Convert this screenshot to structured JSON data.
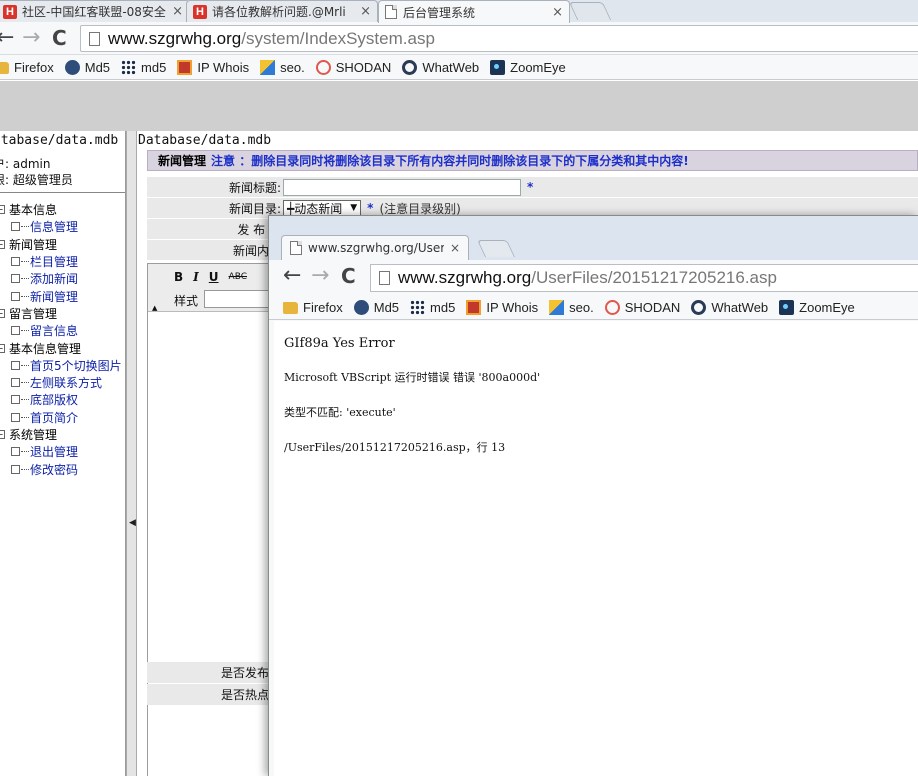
{
  "back_browser": {
    "tabs": [
      {
        "title": "社区-中国红客联盟-08安全",
        "favicon": "h-logo-icon"
      },
      {
        "title": "请各位教解析问题.@Mrli",
        "favicon": "h-logo-icon"
      },
      {
        "title": "后台管理系统",
        "favicon": "page-icon"
      }
    ],
    "close_glyph": "×",
    "back_glyph": "←",
    "forward_glyph": "→",
    "reload_glyph": "C",
    "url_host": "www.szgrwhg.org",
    "url_path": "/system/IndexSystem.asp"
  },
  "bookmarks": [
    {
      "label": "Firefox",
      "icon": "folder"
    },
    {
      "label": "Md5",
      "icon": "md5"
    },
    {
      "label": "md5",
      "icon": "grid"
    },
    {
      "label": "IP Whois",
      "icon": "ipw"
    },
    {
      "label": "seo.",
      "icon": "seo"
    },
    {
      "label": "SHODAN",
      "icon": "shodan"
    },
    {
      "label": "WhatWeb",
      "icon": "ww"
    },
    {
      "label": "ZoomEye",
      "icon": "ze"
    }
  ],
  "sidebar": {
    "db_path": "atabase/data.mdb",
    "user": "户: admin",
    "role": "限: 超级管理员",
    "tree": [
      {
        "label": "基本信息",
        "level": 0
      },
      {
        "label": "信息管理",
        "level": 1
      },
      {
        "label": "新闻管理",
        "level": 0
      },
      {
        "label": "栏目管理",
        "level": 1
      },
      {
        "label": "添加新闻",
        "level": 1
      },
      {
        "label": "新闻管理",
        "level": 1
      },
      {
        "label": "留言管理",
        "level": 0
      },
      {
        "label": "留言信息",
        "level": 1
      },
      {
        "label": "基本信息管理",
        "level": 0
      },
      {
        "label": "首页5个切换图片",
        "level": 1
      },
      {
        "label": "左侧联系方式",
        "level": 1
      },
      {
        "label": "底部版权",
        "level": 1
      },
      {
        "label": "首页简介",
        "level": 1
      },
      {
        "label": "系统管理",
        "level": 0
      },
      {
        "label": "退出管理",
        "level": 1
      },
      {
        "label": "修改密码",
        "level": 1
      }
    ],
    "collapse_glyph": "◀"
  },
  "main": {
    "db_path": "Database/data.mdb",
    "notice_title": "新闻管理",
    "notice_text": "注意 ：删除目录同时将删除该目录下所有内容并同时删除该目录下的下属分类和其中内容!",
    "form": {
      "title_label": "新闻标题:",
      "title_value": "",
      "required_mark": "*",
      "category_label": "新闻目录:",
      "category_value": "┿动态新闻",
      "category_hint": "(注意目录级别)",
      "publisher_label": "发 布 者",
      "content_label": "新闻内容",
      "toolbar_bold": "B",
      "toolbar_italic": "I",
      "toolbar_underline": "U",
      "toolbar_strike": "ABC",
      "style_label": "样式",
      "publish_label": "是否发布",
      "hot_label": "是否热点"
    }
  },
  "popup": {
    "tab_title": "www.szgrwhg.org/UserF",
    "url_host": "www.szgrwhg.org",
    "url_path": "/UserFiles/20151217205216.asp",
    "lines": [
      "GIf89a Yes Error",
      "Microsoft VBScript 运行时错误 错误 '800a000d'",
      "类型不匹配: 'execute'",
      "/UserFiles/20151217205216.asp，行 13"
    ]
  }
}
